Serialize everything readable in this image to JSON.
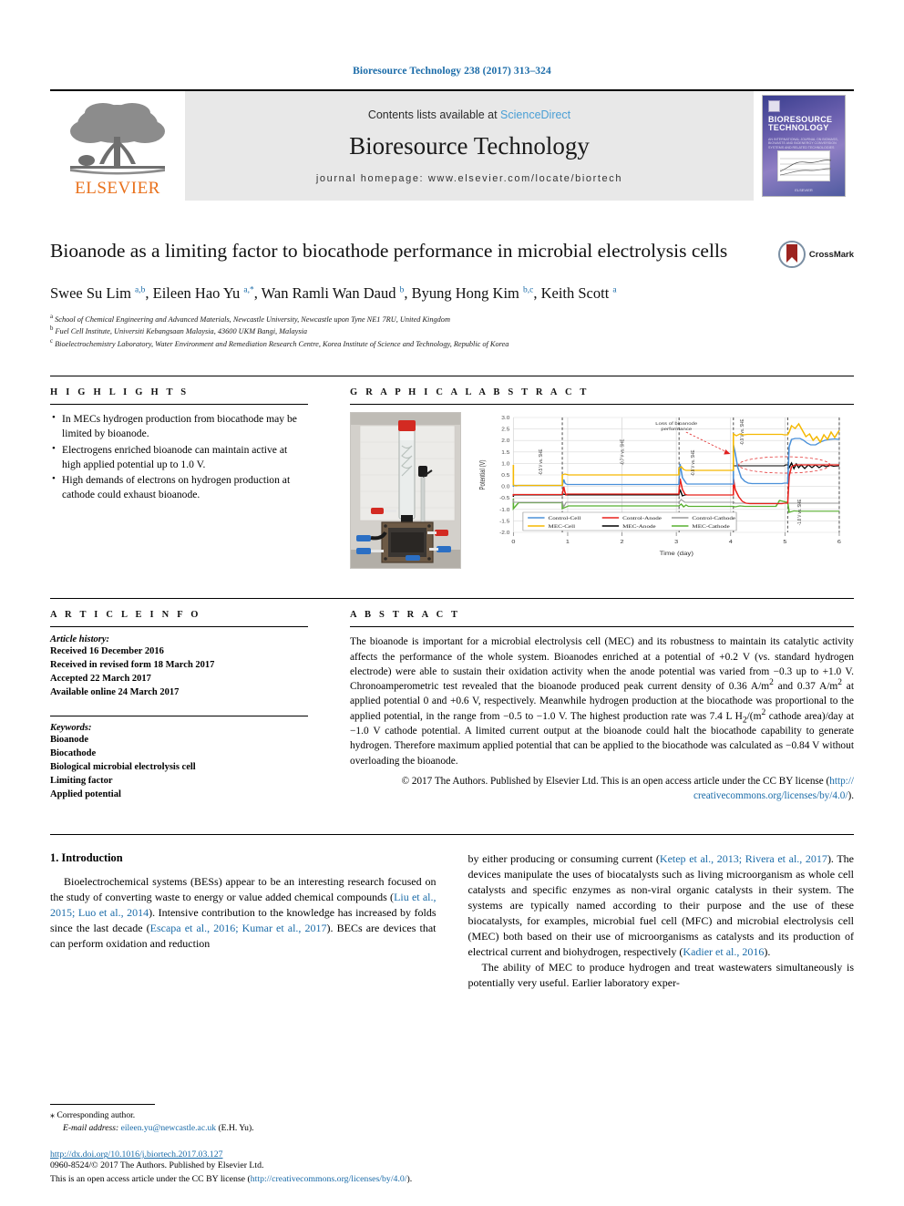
{
  "running_head": "Bioresource Technology 238 (2017) 313–324",
  "masthead": {
    "contents_prefix": "Contents lists available at ",
    "sciencedirect": "ScienceDirect",
    "journal_title": "Bioresource Technology",
    "homepage": "journal homepage: www.elsevier.com/locate/biortech",
    "publisher_name": "ELSEVIER",
    "cover": {
      "title_line1": "BIORESOURCE",
      "title_line2": "TECHNOLOGY",
      "subtitle": "AN INTERNATIONAL JOURNAL ON BIOMASS, BIOWASTE AND BIOENERGY CONVERSION SYSTEMS AND RELATED TECHNOLOGIES",
      "footer": "ELSEVIER"
    }
  },
  "article": {
    "title": "Bioanode as a limiting factor to biocathode performance in microbial electrolysis cells",
    "crossmark_label": "CrossMark",
    "authors_html": "Swee Su Lim <sup>a,b</sup>, Eileen Hao Yu <sup>a,</sup><sup>*</sup>, Wan Ramli Wan Daud <sup>b</sup>, Byung Hong Kim <sup>b,c</sup>, Keith Scott <sup>a</sup>",
    "affiliations": [
      {
        "marker": "a",
        "text": "School of Chemical Engineering and Advanced Materials, Newcastle University, Newcastle upon Tyne NE1 7RU, United Kingdom"
      },
      {
        "marker": "b",
        "text": "Fuel Cell Institute, Universiti Kebangsaan Malaysia, 43600 UKM Bangi, Malaysia"
      },
      {
        "marker": "c",
        "text": "Bioelectrochemistry Laboratory, Water Environment and Remediation Research Centre, Korea Institute of Science and Technology, Republic of Korea"
      }
    ]
  },
  "highlights": {
    "heading": "H I G H L I G H T S",
    "items": [
      "In MECs hydrogen production from biocathode may be limited by bioanode.",
      "Electrogens enriched bioanode can maintain active at high applied potential up to 1.0 V.",
      "High demands of electrons on hydrogen production at cathode could exhaust bioanode."
    ]
  },
  "graphical_abstract": {
    "heading": "G R A P H I C A L   A B S T R A C T",
    "photo_name": "microbial-electrolysis-cell-photo"
  },
  "chart_data": {
    "type": "line",
    "title": "",
    "xlabel": "Time (day)",
    "ylabel": "Potential (V)",
    "xlim": [
      0,
      6
    ],
    "ylim": [
      -2.0,
      3.0
    ],
    "xticks": [
      0,
      1,
      2,
      3,
      4,
      5,
      6
    ],
    "yticks": [
      -2.0,
      -1.5,
      -1.0,
      -0.5,
      0.0,
      0.5,
      1.0,
      1.5,
      2.0,
      2.5,
      3.0
    ],
    "grid": true,
    "legend_position": "bottom-left",
    "series": [
      {
        "name": "Control-Cell",
        "color": "#4a90d9"
      },
      {
        "name": "Control-Anode",
        "color": "#e8201b"
      },
      {
        "name": "Control-Cathode",
        "color": "#9a9a9a"
      },
      {
        "name": "MEC-Cell",
        "color": "#f5b800"
      },
      {
        "name": "MEC-Anode",
        "color": "#000000"
      },
      {
        "name": "MEC-Cathode",
        "color": "#58b030"
      }
    ],
    "annotations": [
      {
        "text": "Loss of bioanode performance",
        "x": 3.5,
        "y": 2.6
      },
      {
        "text": "-0.5 V vs. SHE",
        "x": 0.9,
        "y": 1.4,
        "orientation": "vertical"
      },
      {
        "text": "-0.7 V vs. SHE",
        "x": 2.0,
        "y": 1.6,
        "orientation": "vertical"
      },
      {
        "text": "-0.8 V vs. SHE",
        "x": 3.05,
        "y": 1.4,
        "orientation": "vertical"
      },
      {
        "text": "-0.9 V vs. SHE",
        "x": 4.1,
        "y": 2.4,
        "orientation": "vertical"
      },
      {
        "text": "-1.0 V vs. SHE",
        "x": 5.1,
        "y": -0.6,
        "orientation": "vertical"
      }
    ],
    "dividers": [
      0.9,
      3.05,
      4.05,
      5.05,
      6.0
    ]
  },
  "article_info": {
    "heading": "A R T I C L E   I N F O",
    "history_label": "Article history:",
    "history": [
      "Received 16 December 2016",
      "Received in revised form 18 March 2017",
      "Accepted 22 March 2017",
      "Available online 24 March 2017"
    ],
    "keywords_label": "Keywords:",
    "keywords": [
      "Bioanode",
      "Biocathode",
      "Biological microbial electrolysis cell",
      "Limiting factor",
      "Applied potential"
    ]
  },
  "abstract": {
    "heading": "A B S T R A C T",
    "paragraph_html": "The bioanode is important for a microbial electrolysis cell (MEC) and its robustness to maintain its catalytic activity affects the performance of the whole system. Bioanodes enriched at a potential of +0.2 V (vs. standard hydrogen electrode) were able to sustain their oxidation activity when the anode potential was varied from &#8722;0.3 up to +1.0 V. Chronoamperometric test revealed that the bioanode produced peak current density of 0.36 A/m<sup>2</sup> and 0.37 A/m<sup>2</sup> at applied potential 0 and +0.6 V, respectively. Meanwhile hydrogen production at the biocathode was proportional to the applied potential, in the range from &#8722;0.5 to &#8722;1.0 V. The highest production rate was 7.4 L H<sub>2</sub>/(m<sup>2</sup> cathode area)/day at &#8722;1.0 V cathode potential. A limited current output at the bioanode could halt the biocathode capability to generate hydrogen. Therefore maximum applied potential that can be applied to the biocathode was calculated as &#8722;0.84 V without overloading the bioanode.",
    "copyright_html": "&#169; 2017 The Authors. Published by Elsevier Ltd. This is an open access article under the CC BY license (<span class=\"lnk\">http://<br>creativecommons.org/licenses/by/4.0/</span>)."
  },
  "introduction": {
    "heading": "1. Introduction",
    "left_html": "Bioelectrochemical systems (BESs) appear to be an interesting research focused on the study of converting waste to energy or value added chemical compounds (<span class=\"lnk\">Liu et al., 2015; Luo et al., 2014</span>). Intensive contribution to the knowledge has increased by folds since the last decade (<span class=\"lnk\">Escapa et al., 2016; Kumar et al., 2017</span>). BECs are devices that can perform oxidation and reduction",
    "right_p1_html": "by either producing or consuming current (<span class=\"lnk\">Ketep et al., 2013; Rivera et al., 2017</span>). The devices manipulate the uses of biocatalysts such as living microorganism as whole cell catalysts and specific enzymes as non-viral organic catalysts in their system. The systems are typically named according to their purpose and the use of these biocatalysts, for examples, microbial fuel cell (MFC) and microbial electrolysis cell (MEC) both based on their use of microorganisms as catalysts and its production of electrical current and biohydrogen, respectively (<span class=\"lnk\">Kadier et al., 2016</span>).",
    "right_p2_html": "The ability of MEC to produce hydrogen and treat wastewaters simultaneously is potentially very useful. Earlier laboratory exper-"
  },
  "footnotes": {
    "corresponding_star": "⁎",
    "corresponding_text": "Corresponding author.",
    "email_label": "E-mail address:",
    "email": "eileen.yu@newcastle.ac.uk",
    "email_suffix": "(E.H. Yu)."
  },
  "footer": {
    "doi": "http://dx.doi.org/10.1016/j.biortech.2017.03.127",
    "issn_line_html": "0960-8524/&#169; 2017 The Authors. Published by Elsevier Ltd.",
    "license_line_html": "This is an open access article under the CC BY license (<span class=\"lnk\">http://creativecommons.org/licenses/by/4.0/</span>)."
  },
  "colors": {
    "link": "#1a6ba8",
    "elsevier_orange": "#E9711C",
    "masthead_grey": "#e8e8e8"
  }
}
